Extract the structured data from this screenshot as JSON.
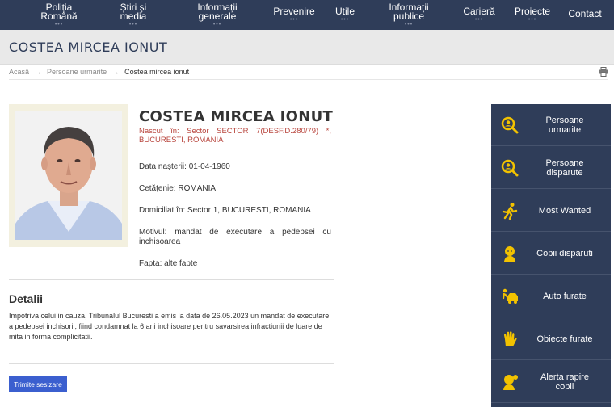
{
  "nav": [
    {
      "label": "Poliția\nRomână",
      "dots": "•••"
    },
    {
      "label": "Știri și\nmedia",
      "dots": "•••"
    },
    {
      "label": "Informații\ngenerale",
      "dots": "•••"
    },
    {
      "label": "Prevenire",
      "dots": "•••"
    },
    {
      "label": "Utile",
      "dots": "•••"
    },
    {
      "label": "Informații\npublice",
      "dots": "•••"
    },
    {
      "label": "Carieră",
      "dots": "•••"
    },
    {
      "label": "Proiecte",
      "dots": "•••"
    },
    {
      "label": "Contact",
      "dots": ""
    }
  ],
  "page_title": "COSTEA MIRCEA IONUT",
  "breadcrumb": {
    "home": "Acasă",
    "sep": "→",
    "section": "Persoane urmarite",
    "current": "Costea mircea ionut"
  },
  "person": {
    "name": "COSTEA MIRCEA IONUT",
    "birthplace": "Nascut în: Sector SECTOR 7(DESF.D.280/79) *, BUCURESTI, ROMANIA",
    "birth_date": "Data nașterii: 01-04-1960",
    "citizenship": "Cetățenie: ROMANIA",
    "domicile": "Domiciliat în: Sector 1, BUCURESTI, ROMANIA",
    "motive": "Motivul: mandat de executare a pedepsei cu inchisoarea",
    "offense": "Fapta: alte fapte"
  },
  "details": {
    "heading": "Detalii",
    "text": "Impotriva celui in cauza, Tribunalul Bucuresti a emis la data de 26.05.2023 un mandat de executare a pedepsei inchisorii, fiind condamnat la 6 ani inchisoare pentru savarsirea infractiunii de luare de mita in forma complicitatii."
  },
  "submit_button": "Trimite sesizare",
  "sidebar": [
    {
      "label": "Persoane\nurmarite",
      "icon": "search-person-icon"
    },
    {
      "label": "Persoane\ndisparute",
      "icon": "search-person-icon"
    },
    {
      "label": "Most Wanted",
      "icon": "running-person-icon"
    },
    {
      "label": "Copii disparuti",
      "icon": "child-icon"
    },
    {
      "label": "Auto furate",
      "icon": "car-icon"
    },
    {
      "label": "Obiecte furate",
      "icon": "hand-icon"
    },
    {
      "label": "Alerta rapire\ncopil",
      "icon": "child-alert-icon"
    }
  ],
  "colors": {
    "nav_bg": "#2f3d59",
    "accent_icon": "#f2c200",
    "birthplace_text": "#b8443c",
    "button": "#3b5fcf"
  }
}
